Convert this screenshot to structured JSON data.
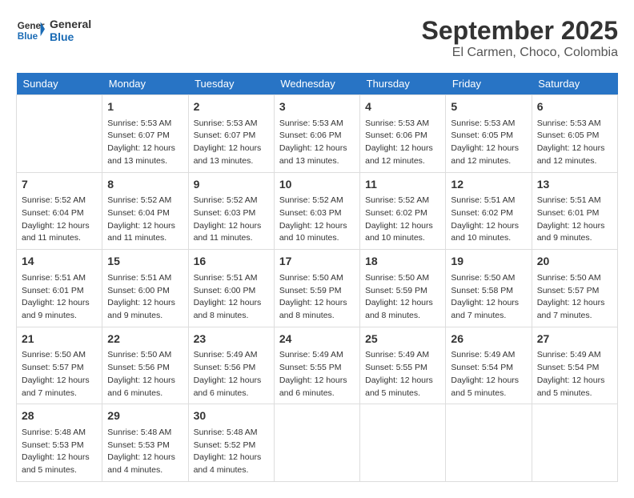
{
  "logo": {
    "text_general": "General",
    "text_blue": "Blue"
  },
  "header": {
    "month": "September 2025",
    "location": "El Carmen, Choco, Colombia"
  },
  "weekdays": [
    "Sunday",
    "Monday",
    "Tuesday",
    "Wednesday",
    "Thursday",
    "Friday",
    "Saturday"
  ],
  "weeks": [
    [
      {
        "day": "",
        "info": ""
      },
      {
        "day": "1",
        "info": "Sunrise: 5:53 AM\nSunset: 6:07 PM\nDaylight: 12 hours\nand 13 minutes."
      },
      {
        "day": "2",
        "info": "Sunrise: 5:53 AM\nSunset: 6:07 PM\nDaylight: 12 hours\nand 13 minutes."
      },
      {
        "day": "3",
        "info": "Sunrise: 5:53 AM\nSunset: 6:06 PM\nDaylight: 12 hours\nand 13 minutes."
      },
      {
        "day": "4",
        "info": "Sunrise: 5:53 AM\nSunset: 6:06 PM\nDaylight: 12 hours\nand 12 minutes."
      },
      {
        "day": "5",
        "info": "Sunrise: 5:53 AM\nSunset: 6:05 PM\nDaylight: 12 hours\nand 12 minutes."
      },
      {
        "day": "6",
        "info": "Sunrise: 5:53 AM\nSunset: 6:05 PM\nDaylight: 12 hours\nand 12 minutes."
      }
    ],
    [
      {
        "day": "7",
        "info": "Sunrise: 5:52 AM\nSunset: 6:04 PM\nDaylight: 12 hours\nand 11 minutes."
      },
      {
        "day": "8",
        "info": "Sunrise: 5:52 AM\nSunset: 6:04 PM\nDaylight: 12 hours\nand 11 minutes."
      },
      {
        "day": "9",
        "info": "Sunrise: 5:52 AM\nSunset: 6:03 PM\nDaylight: 12 hours\nand 11 minutes."
      },
      {
        "day": "10",
        "info": "Sunrise: 5:52 AM\nSunset: 6:03 PM\nDaylight: 12 hours\nand 10 minutes."
      },
      {
        "day": "11",
        "info": "Sunrise: 5:52 AM\nSunset: 6:02 PM\nDaylight: 12 hours\nand 10 minutes."
      },
      {
        "day": "12",
        "info": "Sunrise: 5:51 AM\nSunset: 6:02 PM\nDaylight: 12 hours\nand 10 minutes."
      },
      {
        "day": "13",
        "info": "Sunrise: 5:51 AM\nSunset: 6:01 PM\nDaylight: 12 hours\nand 9 minutes."
      }
    ],
    [
      {
        "day": "14",
        "info": "Sunrise: 5:51 AM\nSunset: 6:01 PM\nDaylight: 12 hours\nand 9 minutes."
      },
      {
        "day": "15",
        "info": "Sunrise: 5:51 AM\nSunset: 6:00 PM\nDaylight: 12 hours\nand 9 minutes."
      },
      {
        "day": "16",
        "info": "Sunrise: 5:51 AM\nSunset: 6:00 PM\nDaylight: 12 hours\nand 8 minutes."
      },
      {
        "day": "17",
        "info": "Sunrise: 5:50 AM\nSunset: 5:59 PM\nDaylight: 12 hours\nand 8 minutes."
      },
      {
        "day": "18",
        "info": "Sunrise: 5:50 AM\nSunset: 5:59 PM\nDaylight: 12 hours\nand 8 minutes."
      },
      {
        "day": "19",
        "info": "Sunrise: 5:50 AM\nSunset: 5:58 PM\nDaylight: 12 hours\nand 7 minutes."
      },
      {
        "day": "20",
        "info": "Sunrise: 5:50 AM\nSunset: 5:57 PM\nDaylight: 12 hours\nand 7 minutes."
      }
    ],
    [
      {
        "day": "21",
        "info": "Sunrise: 5:50 AM\nSunset: 5:57 PM\nDaylight: 12 hours\nand 7 minutes."
      },
      {
        "day": "22",
        "info": "Sunrise: 5:50 AM\nSunset: 5:56 PM\nDaylight: 12 hours\nand 6 minutes."
      },
      {
        "day": "23",
        "info": "Sunrise: 5:49 AM\nSunset: 5:56 PM\nDaylight: 12 hours\nand 6 minutes."
      },
      {
        "day": "24",
        "info": "Sunrise: 5:49 AM\nSunset: 5:55 PM\nDaylight: 12 hours\nand 6 minutes."
      },
      {
        "day": "25",
        "info": "Sunrise: 5:49 AM\nSunset: 5:55 PM\nDaylight: 12 hours\nand 5 minutes."
      },
      {
        "day": "26",
        "info": "Sunrise: 5:49 AM\nSunset: 5:54 PM\nDaylight: 12 hours\nand 5 minutes."
      },
      {
        "day": "27",
        "info": "Sunrise: 5:49 AM\nSunset: 5:54 PM\nDaylight: 12 hours\nand 5 minutes."
      }
    ],
    [
      {
        "day": "28",
        "info": "Sunrise: 5:48 AM\nSunset: 5:53 PM\nDaylight: 12 hours\nand 5 minutes."
      },
      {
        "day": "29",
        "info": "Sunrise: 5:48 AM\nSunset: 5:53 PM\nDaylight: 12 hours\nand 4 minutes."
      },
      {
        "day": "30",
        "info": "Sunrise: 5:48 AM\nSunset: 5:52 PM\nDaylight: 12 hours\nand 4 minutes."
      },
      {
        "day": "",
        "info": ""
      },
      {
        "day": "",
        "info": ""
      },
      {
        "day": "",
        "info": ""
      },
      {
        "day": "",
        "info": ""
      }
    ]
  ]
}
